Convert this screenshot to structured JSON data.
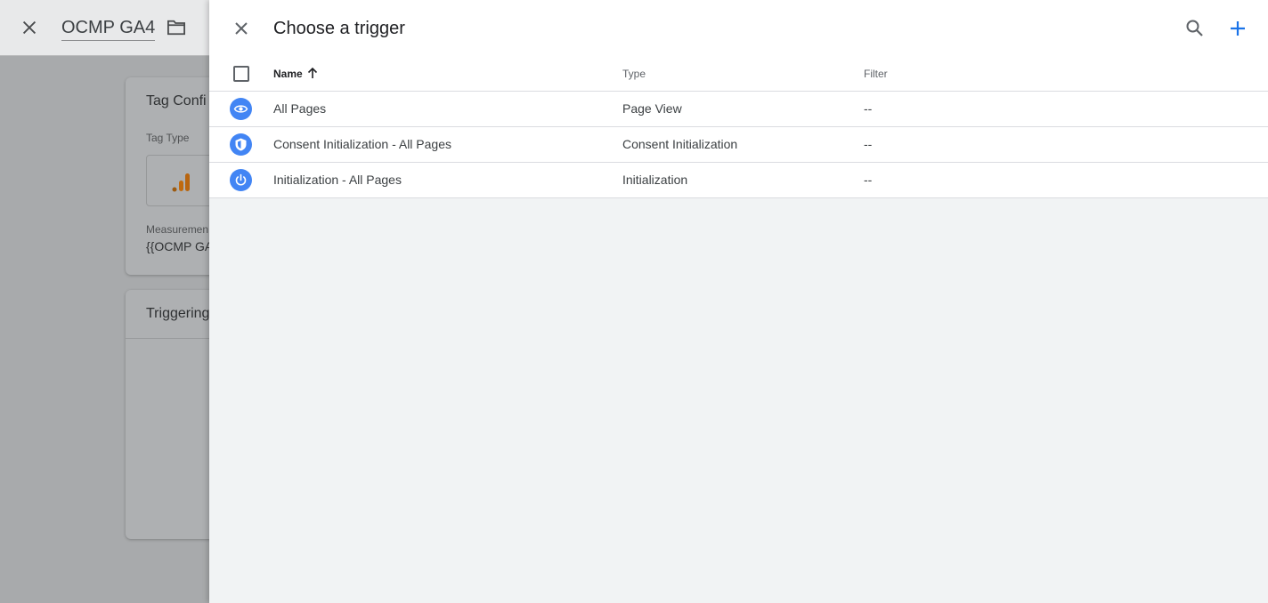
{
  "background": {
    "tag_title": "OCMP GA4",
    "config_card_title": "Tag Confi",
    "tag_type_label": "Tag Type",
    "measurement_label": "Measuremen",
    "measurement_value": "{{OCMP GA",
    "triggering_card_title": "Triggering"
  },
  "panel": {
    "title": "Choose a trigger",
    "columns": {
      "name": "Name",
      "type": "Type",
      "filter": "Filter"
    },
    "rows": [
      {
        "name": "All Pages",
        "type": "Page View",
        "filter": "--",
        "icon": "eye-icon"
      },
      {
        "name": "Consent Initialization - All Pages",
        "type": "Consent Initialization",
        "filter": "--",
        "icon": "shield-icon"
      },
      {
        "name": "Initialization - All Pages",
        "type": "Initialization",
        "filter": "--",
        "icon": "power-icon"
      }
    ]
  },
  "colors": {
    "accent": "#1a73e8",
    "icon_bg": "#4285f4",
    "panel_bg": "#f1f3f4",
    "ga_orange": "#e37400"
  }
}
